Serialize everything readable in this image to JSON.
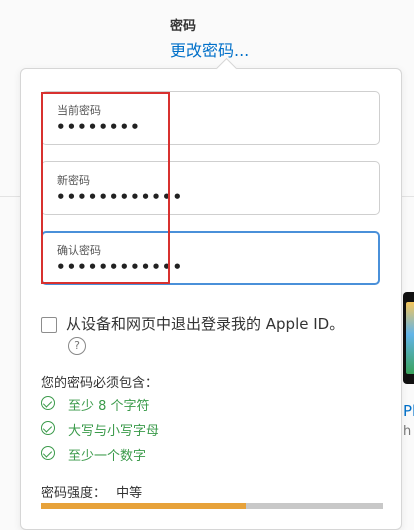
{
  "header": {
    "section_label": "密码",
    "change_link": "更改密码..."
  },
  "form": {
    "fields": [
      {
        "label": "当前密码",
        "value": "••••••••"
      },
      {
        "label": "新密码",
        "value": "••••••••••••"
      },
      {
        "label": "确认密码",
        "value": "••••••••••••"
      }
    ],
    "signout_checkbox": {
      "label": "从设备和网页中退出登录我的 Apple ID。",
      "checked": false
    },
    "help_icon_symbol": "?",
    "requirements": {
      "title": "您的密码必须包含：",
      "items": [
        "至少 8 个字符",
        "大写与小写字母",
        "至少一个数字"
      ],
      "color": "#3a9a4a"
    },
    "strength": {
      "label": "密码强度：",
      "value": "中等",
      "level": 0.6,
      "color": "#e7a23a"
    }
  },
  "background": {
    "cut_text": "Pl",
    "cut_text2": "h"
  },
  "colors": {
    "link": "#0070c9",
    "annotation": "#d8312f",
    "focus": "#4a90d9"
  }
}
